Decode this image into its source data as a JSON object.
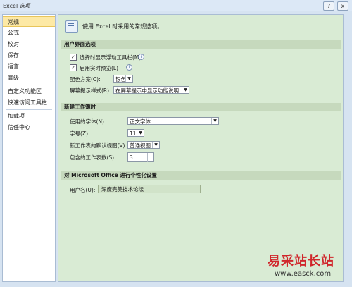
{
  "window": {
    "title": "Excel 选项",
    "help_label": "?",
    "close_label": "x"
  },
  "sidebar": {
    "items": [
      {
        "label": "常规",
        "selected": true
      },
      {
        "label": "公式"
      },
      {
        "label": "校对"
      },
      {
        "label": "保存"
      },
      {
        "label": "语言"
      },
      {
        "label": "高级"
      },
      {
        "label": "自定义功能区"
      },
      {
        "label": "快速访问工具栏"
      },
      {
        "label": "加载项"
      },
      {
        "label": "信任中心"
      }
    ]
  },
  "main": {
    "intro": "使用 Excel 时采用的常规选项。",
    "ui_section": {
      "title": "用户界面选项",
      "checkbox_mini_toolbar": {
        "label": "选择时显示浮动工具栏(M)",
        "checked": true
      },
      "checkbox_live_preview": {
        "label": "启用实时预览(L)",
        "checked": true
      },
      "color_scheme": {
        "label": "配色方案(C):",
        "value": "银色"
      },
      "screentip": {
        "label": "屏幕提示样式(R):",
        "value": "在屏幕提示中显示功能说明"
      }
    },
    "new_workbook_section": {
      "title": "新建工作簿时",
      "font": {
        "label": "使用的字体(N):",
        "value": "正文字体"
      },
      "font_size": {
        "label": "字号(Z):",
        "value": "11"
      },
      "default_view": {
        "label": "新工作表的默认视图(V):",
        "value": "普通视图"
      },
      "sheet_count": {
        "label": "包含的工作表数(S):",
        "value": "3"
      }
    },
    "personalize_section": {
      "title": "对 Microsoft Office 进行个性化设置",
      "username": {
        "label": "用户名(U):",
        "value": "深度完美技术论坛"
      }
    }
  },
  "watermark": {
    "text": "易采站长站",
    "url": "www.easck.com",
    "color": "#d0262b"
  },
  "colors": {
    "accent": "#d9ebd4",
    "section": "#c6d9bd",
    "selected_nav": "#fde9a5"
  }
}
